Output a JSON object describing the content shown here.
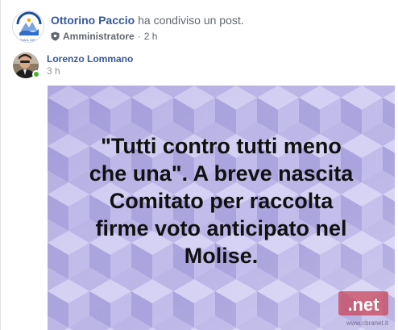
{
  "sharer": {
    "name": "Ottorino Paccio",
    "action": "ha condiviso un post.",
    "role": "Amministratore",
    "time": "2 h",
    "avatar_logo_text": "PRIMA IL MOLISE"
  },
  "author": {
    "name": "Lorenzo Lommano",
    "time": "3 h",
    "online": true
  },
  "post": {
    "text": "\"Tutti contro tutti meno\nche una\". A breve nascita\nComitato per raccolta\nfirme voto anticipato nel\nMolise.",
    "watermark_logo": ".net",
    "watermark_url": "www.cbranet.it",
    "background_color": "#b9b3e6"
  },
  "colors": {
    "link": "#365899",
    "meta": "#616770",
    "online": "#42b72a"
  }
}
